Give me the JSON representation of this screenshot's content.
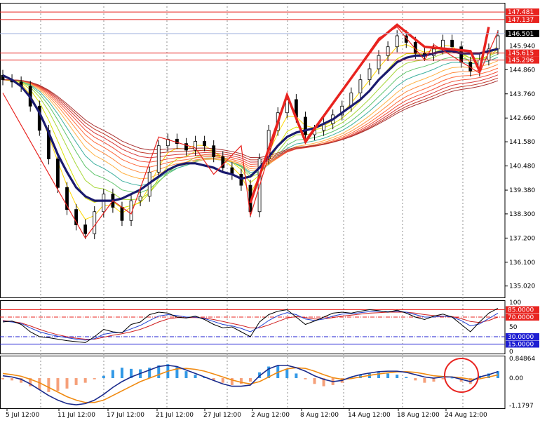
{
  "chart_data": [
    {
      "type": "line",
      "panel": "price",
      "y_ticks": [
        "144.860",
        "143.760",
        "142.660",
        "141.580",
        "140.480",
        "139.380",
        "138.300",
        "137.200",
        "136.100",
        "135.020"
      ],
      "y_range": [
        134.5,
        147.9
      ],
      "price_tags": [
        {
          "label": "147.481",
          "value": 147.481,
          "color": "#e8231f"
        },
        {
          "label": "147.137",
          "value": 147.137,
          "color": "#e8231f"
        },
        {
          "label": "146.501",
          "value": 146.501,
          "color": "#000000"
        },
        {
          "label": "145.940",
          "value": 145.94,
          "color": "none"
        },
        {
          "label": "145.615",
          "value": 145.615,
          "color": "#e8231f"
        },
        {
          "label": "145.296",
          "value": 145.296,
          "color": "#e8231f"
        }
      ],
      "horizontal_lines": [
        147.481,
        147.137,
        145.615,
        145.296
      ],
      "x_labels": [
        "5 Jul 12:00",
        "11 Jul 12:00",
        "17 Jul 12:00",
        "21 Jul 12:00",
        "27 Jul 12:00",
        "2 Aug 12:00",
        "8 Aug 12:00",
        "14 Aug 12:00",
        "18 Aug 12:00",
        "24 Aug 12:00"
      ],
      "close_series": [
        144.4,
        144.3,
        144.1,
        143.2,
        142.1,
        140.8,
        139.5,
        138.5,
        137.8,
        137.4,
        138.4,
        139.2,
        138.6,
        138.0,
        138.9,
        139.1,
        140.2,
        141.4,
        141.7,
        141.5,
        141.2,
        141.6,
        141.4,
        140.9,
        140.4,
        140.1,
        139.6,
        138.4,
        140.8,
        142.1,
        142.9,
        143.5,
        142.7,
        141.9,
        142.1,
        142.4,
        142.8,
        143.2,
        143.8,
        144.4,
        144.9,
        145.5,
        145.9,
        146.4,
        146.1,
        145.6,
        145.5,
        145.8,
        146.2,
        145.9,
        145.2,
        144.8,
        145.3,
        145.8,
        146.4
      ],
      "ma_slow": [
        144.6,
        144.4,
        144.1,
        143.6,
        142.9,
        142.0,
        141.0,
        140.2,
        139.5,
        139.1,
        138.9,
        138.9,
        138.9,
        139.0,
        139.2,
        139.4,
        139.7,
        140.0,
        140.3,
        140.5,
        140.6,
        140.6,
        140.5,
        140.4,
        140.2,
        140.1,
        139.9,
        140.0,
        140.4,
        140.9,
        141.4,
        141.8,
        142.0,
        142.1,
        142.2,
        142.4,
        142.6,
        142.9,
        143.2,
        143.5,
        143.9,
        144.4,
        144.8,
        145.2,
        145.4,
        145.5,
        145.5,
        145.6,
        145.7,
        145.7,
        145.6,
        145.6,
        145.6,
        145.7,
        145.8
      ],
      "zigzag_thin": [
        [
          0,
          143.8
        ],
        [
          9,
          137.2
        ],
        [
          12,
          138.9
        ],
        [
          14,
          138.3
        ],
        [
          17,
          141.8
        ],
        [
          21,
          141.3
        ],
        [
          23,
          140.1
        ],
        [
          26,
          141.4
        ],
        [
          27,
          138.2
        ],
        [
          31,
          143.7
        ],
        [
          33,
          141.5
        ],
        [
          41,
          146.3
        ],
        [
          43,
          146.8
        ],
        [
          46,
          145.3
        ],
        [
          47,
          146.0
        ],
        [
          52,
          144.7
        ],
        [
          54,
          146.6
        ]
      ],
      "zigzag_thick": [
        [
          27,
          138.8
        ],
        [
          31,
          143.7
        ],
        [
          33,
          141.6
        ],
        [
          41,
          146.2
        ],
        [
          43,
          146.9
        ],
        [
          46,
          145.9
        ],
        [
          51,
          145.7
        ],
        [
          52,
          144.8
        ],
        [
          53,
          146.8
        ]
      ]
    },
    {
      "type": "line",
      "panel": "rsi",
      "y_ticks": [
        "100",
        "50",
        "0"
      ],
      "level_tags": [
        {
          "label": "85.0000",
          "value": 85,
          "color": "#e8231f"
        },
        {
          "label": "70.0000",
          "value": 70,
          "color": "#e8231f"
        },
        {
          "label": "30.0000",
          "value": 30,
          "color": "#1e1ed2"
        },
        {
          "label": "15.0000",
          "value": 15,
          "color": "#1e1ed2"
        }
      ],
      "rsi_fast": [
        60,
        62,
        55,
        40,
        30,
        28,
        25,
        22,
        20,
        18,
        30,
        45,
        40,
        38,
        55,
        60,
        75,
        80,
        78,
        70,
        68,
        72,
        65,
        55,
        48,
        50,
        40,
        30,
        60,
        75,
        82,
        85,
        70,
        55,
        62,
        70,
        78,
        80,
        78,
        82,
        85,
        83,
        80,
        84,
        78,
        70,
        65,
        72,
        76,
        70,
        55,
        40,
        60,
        78,
        88
      ],
      "rsi_slow": [
        62,
        60,
        57,
        48,
        40,
        35,
        31,
        28,
        25,
        23,
        26,
        35,
        38,
        39,
        46,
        53,
        63,
        72,
        75,
        73,
        70,
        70,
        67,
        61,
        55,
        52,
        47,
        40,
        50,
        63,
        73,
        79,
        75,
        66,
        63,
        66,
        72,
        76,
        77,
        79,
        81,
        82,
        81,
        82,
        80,
        75,
        70,
        70,
        72,
        70,
        63,
        52,
        56,
        67,
        78
      ],
      "rsi_ma": [
        63,
        61,
        58,
        52,
        45,
        39,
        34,
        30,
        27,
        25,
        25,
        29,
        33,
        36,
        40,
        45,
        52,
        60,
        66,
        69,
        69,
        69,
        68,
        65,
        61,
        57,
        53,
        48,
        48,
        54,
        61,
        68,
        71,
        69,
        66,
        66,
        69,
        72,
        74,
        76,
        78,
        79,
        80,
        80,
        80,
        78,
        75,
        73,
        72,
        71,
        67,
        61,
        59,
        63,
        70
      ]
    },
    {
      "type": "bar",
      "panel": "macd",
      "y_ticks": [
        "0.84864",
        "0.00",
        "-1.1797"
      ],
      "y_range": [
        -1.1797,
        0.84864
      ],
      "histogram": [
        -0.05,
        -0.1,
        -0.2,
        -0.35,
        -0.5,
        -0.6,
        -0.55,
        -0.45,
        -0.3,
        -0.2,
        -0.05,
        0.1,
        0.35,
        0.45,
        0.4,
        0.38,
        0.45,
        0.55,
        0.6,
        0.5,
        0.3,
        0.15,
        0.05,
        -0.1,
        -0.2,
        -0.3,
        -0.25,
        -0.15,
        0.25,
        0.5,
        0.55,
        0.4,
        0.2,
        -0.05,
        -0.25,
        -0.35,
        -0.3,
        -0.2,
        0.05,
        0.15,
        0.2,
        0.25,
        0.2,
        0.15,
        0.05,
        -0.1,
        -0.2,
        -0.15,
        -0.05,
        0.02,
        -0.15,
        -0.25,
        0.1,
        0.2,
        0.3
      ],
      "macd_line": [
        0.1,
        0.05,
        -0.05,
        -0.25,
        -0.5,
        -0.75,
        -0.95,
        -1.1,
        -1.15,
        -1.1,
        -0.95,
        -0.7,
        -0.4,
        -0.15,
        0.05,
        0.2,
        0.35,
        0.5,
        0.55,
        0.5,
        0.35,
        0.2,
        0.05,
        -0.1,
        -0.25,
        -0.35,
        -0.35,
        -0.3,
        0.1,
        0.4,
        0.55,
        0.55,
        0.45,
        0.3,
        0.1,
        -0.05,
        -0.15,
        -0.1,
        0.05,
        0.15,
        0.22,
        0.28,
        0.3,
        0.3,
        0.25,
        0.15,
        0.05,
        0.0,
        0.05,
        0.05,
        -0.05,
        -0.15,
        0.05,
        0.15,
        0.28
      ],
      "signal_line": [
        0.2,
        0.15,
        0.08,
        -0.05,
        -0.2,
        -0.4,
        -0.6,
        -0.8,
        -0.95,
        -1.05,
        -1.05,
        -0.95,
        -0.75,
        -0.55,
        -0.35,
        -0.15,
        0.0,
        0.15,
        0.3,
        0.4,
        0.42,
        0.38,
        0.3,
        0.18,
        0.05,
        -0.08,
        -0.18,
        -0.25,
        -0.15,
        0.05,
        0.25,
        0.4,
        0.45,
        0.42,
        0.3,
        0.15,
        0.02,
        -0.05,
        -0.02,
        0.05,
        0.12,
        0.18,
        0.23,
        0.27,
        0.28,
        0.25,
        0.18,
        0.1,
        0.07,
        0.05,
        0.02,
        -0.05,
        -0.03,
        0.05,
        0.14
      ]
    }
  ]
}
